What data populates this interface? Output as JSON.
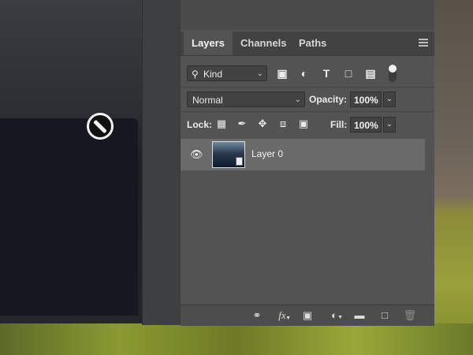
{
  "tabs": [
    {
      "label": "Layers",
      "active": true
    },
    {
      "label": "Channels",
      "active": false
    },
    {
      "label": "Paths",
      "active": false
    }
  ],
  "filter": {
    "kind_label": "Kind",
    "icons": [
      "image-filter-icon",
      "adjustment-filter-icon",
      "type-filter-icon",
      "shape-filter-icon",
      "smart-object-filter-icon"
    ]
  },
  "blend": {
    "mode": "Normal",
    "opacity_label": "Opacity:",
    "opacity_value": "100%"
  },
  "lock": {
    "label": "Lock:",
    "fill_label": "Fill:",
    "fill_value": "100%"
  },
  "layers": [
    {
      "name": "Layer 0",
      "visible": true
    }
  ],
  "footer_icons": [
    "link-icon",
    "fx-icon",
    "mask-icon",
    "adjustment-layer-icon",
    "folder-icon",
    "new-layer-icon",
    "trash-icon"
  ],
  "colors": {
    "panel": "#535353",
    "selected_row": "#6a6a6a"
  }
}
